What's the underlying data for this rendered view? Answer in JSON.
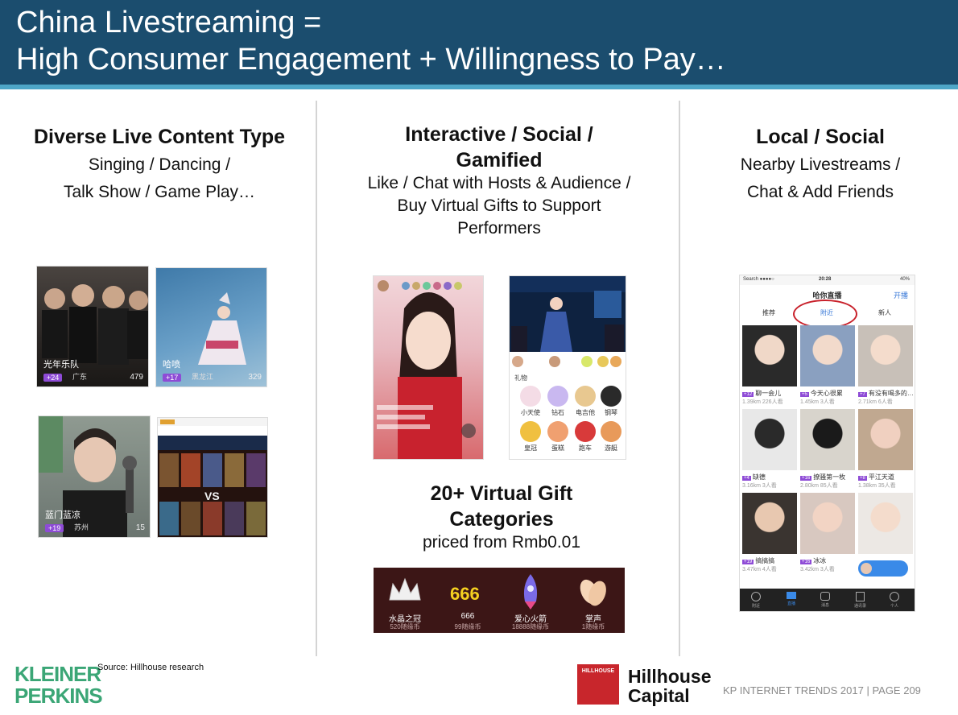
{
  "header": {
    "title_line1": "China Livestreaming =",
    "title_line2": "High Consumer Engagement + Willingness to Pay…"
  },
  "col1": {
    "heading": "Diverse Live Content Type",
    "sub1": "Singing / Dancing /",
    "sub2": "Talk Show / Game Play…",
    "thumbs": [
      {
        "label": "光年乐队",
        "tag": "+24",
        "place": "广东",
        "count": "479"
      },
      {
        "label": "哈喷",
        "tag": "+17",
        "place": "黑龙江",
        "count": "329"
      },
      {
        "label": "蓝门蓝凉",
        "tag": "+19",
        "place": "苏州",
        "count": "15"
      }
    ]
  },
  "col2": {
    "heading1": "Interactive / Social /",
    "heading2": "Gamified",
    "sub1": "Like / Chat with Hosts & Audience /",
    "sub2": "Buy Virtual Gifts to Support",
    "sub3": "Performers",
    "gift_heading1": "20+ Virtual Gift",
    "gift_heading2": "Categories",
    "gift_sub": "priced from Rmb0.01",
    "gift_tab": "礼物",
    "gift_grid": [
      "小天使",
      "钻石",
      "电吉他",
      "钢琴",
      "皇冠",
      "蛋糕",
      "跑车",
      "游艇"
    ],
    "bar_gifts": [
      {
        "name": "水晶之冠",
        "price": "520随缘币"
      },
      {
        "name": "666",
        "price": "99随缘币"
      },
      {
        "name": "爱心火箭",
        "price": "18888随缘币"
      },
      {
        "name": "掌声",
        "price": "1随缘币"
      }
    ]
  },
  "col3": {
    "heading": "Local / Social",
    "sub1": "Nearby Livestreams /",
    "sub2": "Chat & Add Friends",
    "phone": {
      "status_left": "Search ●●●●○",
      "time": "20:28",
      "battery": "40%",
      "app_title": "哈你直播",
      "action": "开播",
      "tabs": [
        "推荐",
        "附近",
        "新人"
      ],
      "grid": [
        {
          "name": "聊一会儿",
          "tag": "+12",
          "meta": "1.39km  226人看"
        },
        {
          "name": "今天心很累",
          "tag": "+5",
          "meta": "1.45km  3人看"
        },
        {
          "name": "有没有喝多的…",
          "tag": "+7",
          "meta": "2.71km  6人看"
        },
        {
          "name": "缺德",
          "tag": "+4",
          "meta": "3.16km  3人看"
        },
        {
          "name": "撩骚第一枚",
          "tag": "+16",
          "meta": "2.80km  85人看"
        },
        {
          "name": "平江天道",
          "tag": "+8",
          "meta": "1.38km  35人看"
        },
        {
          "name": "搞搞搞",
          "tag": "+19",
          "meta": "3.47km  4人看"
        },
        {
          "name": "冰冰",
          "tag": "+16",
          "meta": "3.42km  3人看"
        },
        {
          "name": "",
          "tag": "",
          "meta": ""
        }
      ],
      "nav": [
        "附近",
        "直播",
        "消息",
        "通讯录",
        "个人"
      ]
    }
  },
  "footer": {
    "kp_line1": "KLEINER",
    "kp_line2": "PERKINS",
    "source": "Source: Hillhouse research",
    "hh_logo_text": "HILLHOUSE",
    "hh_line1": "Hillhouse",
    "hh_line2": "Capital",
    "meta": "KP INTERNET TRENDS 2017   |   PAGE 209"
  },
  "colors": {
    "header": "#1b4d6e",
    "header_stripe": "#4ea6c7",
    "kp_green": "#3ba676",
    "hillhouse_red": "#c8262c"
  }
}
